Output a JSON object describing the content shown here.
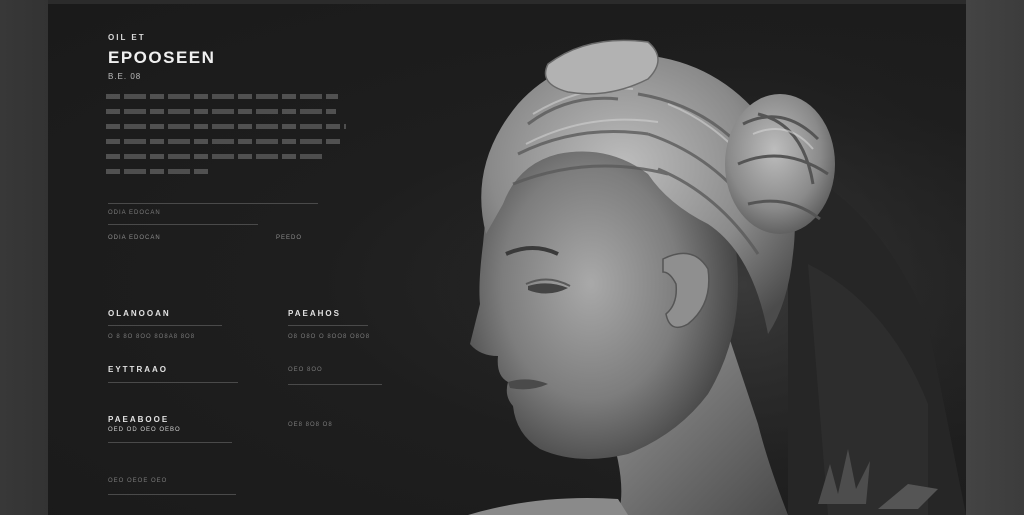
{
  "header": {
    "eyebrow": "OIL ET",
    "title": "EPOOSEEN",
    "subtitle": "B.E. 08"
  },
  "intro": {
    "lines": 6
  },
  "meta": {
    "label_a": "ODIA EDOCAN",
    "label_b": "PEEDO"
  },
  "sections": {
    "s1_label": "OLANOOAN",
    "s1_caption": "O 8 8O 8OO 8O8A8 8O8",
    "s2_label": "PAEAHOS",
    "s2_caption": "O8 O8O O 8OO8 O8O8",
    "s3_label": "EYTTRAAO",
    "s3_caption": "OEO 8OO",
    "s4_label": "PAEABOOE",
    "s4_sub": "OED OD OEO OEBO",
    "s4_caption": "OE8 8O8 O8",
    "s5_caption": "OEO OEOE OEO"
  },
  "colors": {
    "panel": "#1e1e1e",
    "frame": "#3a3a3a",
    "text": "#e2e2e2"
  }
}
